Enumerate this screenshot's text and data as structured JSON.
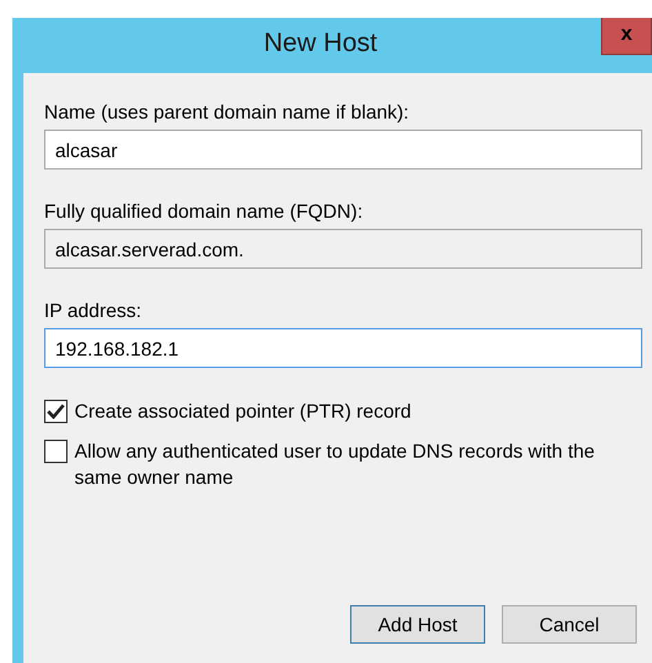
{
  "window": {
    "title": "New Host",
    "close": "x"
  },
  "fields": [
    {
      "label": "Name (uses parent domain name if blank):",
      "value": "alcasar",
      "readonly": false,
      "focused": false
    },
    {
      "label": "Fully qualified domain name (FQDN):",
      "value": "alcasar.serverad.com.",
      "readonly": true,
      "focused": false
    },
    {
      "label": "IP address:",
      "value": "192.168.182.1",
      "readonly": false,
      "focused": true
    }
  ],
  "checkboxes": [
    {
      "label": "Create associated pointer (PTR) record",
      "checked": true
    },
    {
      "label": "Allow any authenticated user to update DNS records with the same owner name",
      "checked": false
    }
  ],
  "buttons": [
    {
      "label": "Add Host",
      "default": true
    },
    {
      "label": "Cancel",
      "default": false
    }
  ]
}
